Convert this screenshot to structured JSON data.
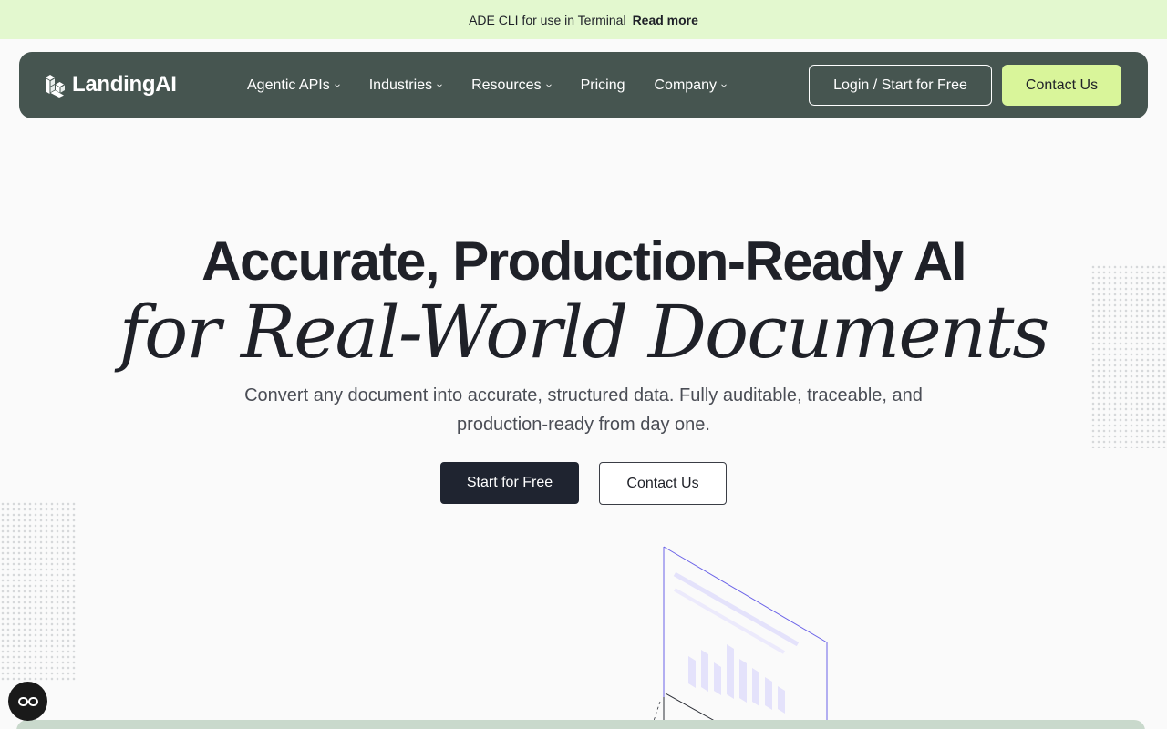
{
  "announcement": {
    "text": "ADE CLI for use in Terminal",
    "link": "Read more"
  },
  "nav": {
    "logo_text": "LandingAI",
    "menu": [
      {
        "label": "Agentic APIs",
        "has_dropdown": true
      },
      {
        "label": "Industries",
        "has_dropdown": true
      },
      {
        "label": "Resources",
        "has_dropdown": true
      },
      {
        "label": "Pricing",
        "has_dropdown": false
      },
      {
        "label": "Company",
        "has_dropdown": true
      }
    ],
    "login_label": "Login / Start for Free",
    "contact_label": "Contact Us"
  },
  "hero": {
    "title": "Accurate, Production-Ready AI",
    "title_italic": "for Real-World Documents",
    "subtitle": "Convert any document into accurate, structured data. Fully auditable, traceable, and production-ready from day one.",
    "primary_cta": "Start for Free",
    "secondary_cta": "Contact Us"
  },
  "colors": {
    "announcement_bg": "#e3f8cf",
    "nav_bg": "#465550",
    "accent_green": "#d9f59a",
    "primary_dark": "#1f2430",
    "illustration_line": "#6b63e8"
  },
  "icons": {
    "logo": "landingai-logo-icon",
    "dropdown": "chevron-down-icon",
    "fab": "glasses-icon"
  }
}
